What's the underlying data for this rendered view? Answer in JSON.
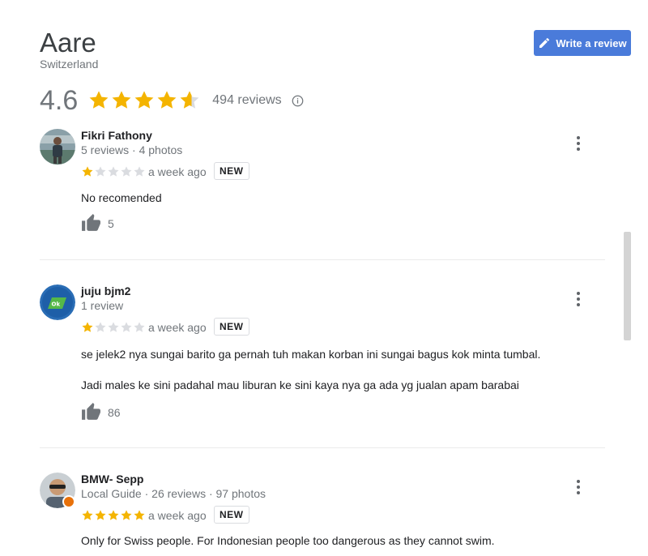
{
  "place": {
    "name": "Aare",
    "location": "Switzerland",
    "rating": "4.6",
    "rating_value": 4.6,
    "reviews_count": "494 reviews"
  },
  "actions": {
    "write_review_label": "Write a review"
  },
  "colors": {
    "star": "#f4b400",
    "star_empty": "#dadce0",
    "accent": "#4a7bda"
  },
  "reviews": [
    {
      "author": "Fikri Fathony",
      "meta": "5 reviews · 4 photos",
      "stars": 1,
      "time": "a week ago",
      "badge": "NEW",
      "text": [
        "No recomended"
      ],
      "likes": "5"
    },
    {
      "author": "juju bjm2",
      "meta": "1 review",
      "stars": 1,
      "time": "a week ago",
      "badge": "NEW",
      "text": [
        "se jelek2 nya sungai barito ga pernah tuh makan korban ini sungai bagus kok minta tumbal.",
        "Jadi males ke sini padahal mau liburan ke sini kaya nya ga ada yg jualan apam barabai"
      ],
      "likes": "86"
    },
    {
      "author": "BMW- Sepp",
      "meta": "Local Guide · 26 reviews · 97 photos",
      "stars": 5,
      "time": "a week ago",
      "badge": "NEW",
      "text": [
        "Only for Swiss people. For Indonesian people too dangerous as they cannot swim."
      ]
    }
  ]
}
